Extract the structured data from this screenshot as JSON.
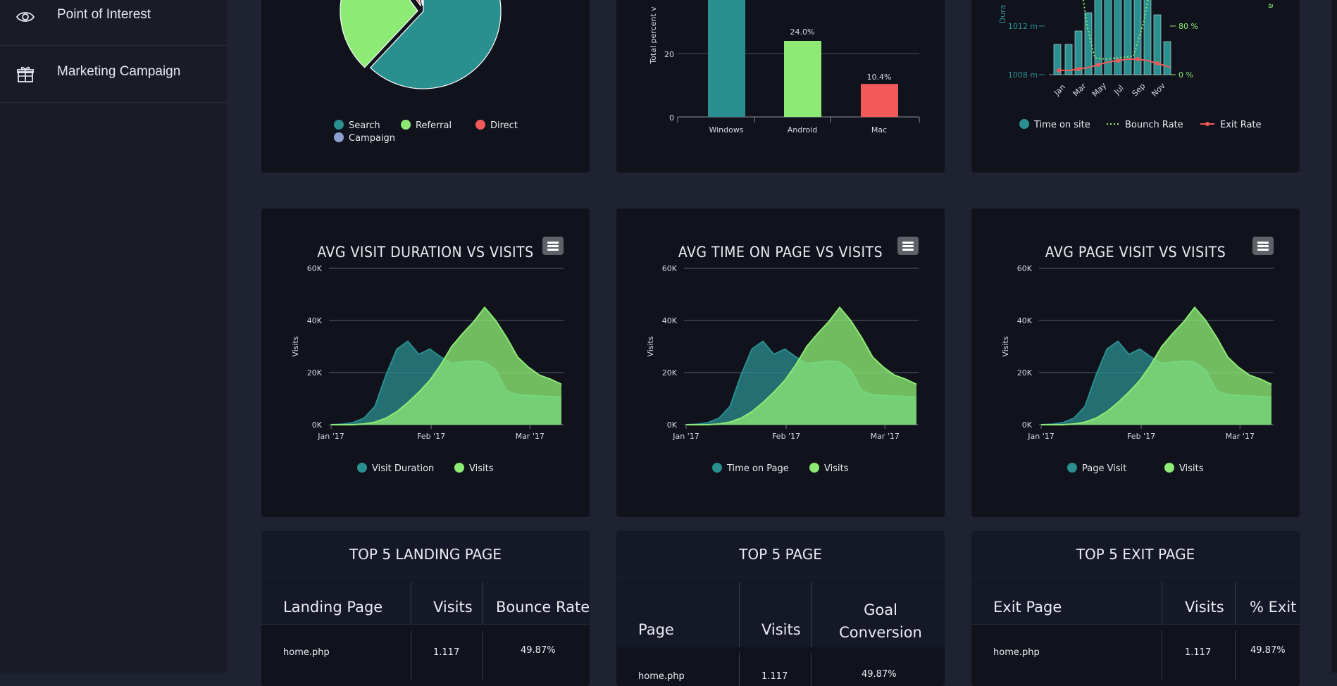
{
  "sidebar": {
    "items": [
      {
        "label": "Point of Interest",
        "icon": "eye-icon"
      },
      {
        "label": "Marketing Campaign",
        "icon": "gift-icon"
      }
    ]
  },
  "colors": {
    "teal": "#2a8f8f",
    "green": "#8deb75",
    "red": "#f25a5a",
    "blue": "#8b9fd1",
    "background": "#1f2231",
    "card": "#11131c"
  },
  "top_cards": {
    "pie": {
      "legend": [
        "Search",
        "Referral",
        "Direct",
        "Campaign"
      ]
    },
    "bar": {
      "ylabel": "Total percent v",
      "y_ticks": [
        "0",
        "20"
      ],
      "categories": [
        "Windows",
        "Android",
        "Mac"
      ],
      "labels": [
        "24.0%",
        "10.4%"
      ]
    },
    "combo": {
      "y_left_label": "Dura",
      "y_left_ticks": [
        "1012 m",
        "1008 m"
      ],
      "y_right_ticks": [
        "80 %",
        "0 %"
      ],
      "y_right_label": "a",
      "months": [
        "Jan",
        "Mar",
        "May",
        "Jul",
        "Sep",
        "Nov"
      ],
      "legend": [
        "Time on site",
        "Bounch Rate",
        "Exit Rate"
      ]
    }
  },
  "area_charts": [
    {
      "title": "AVG VISIT DURATION VS VISITS",
      "legend": [
        "Visit Duration",
        "Visits"
      ]
    },
    {
      "title": "AVG TIME ON PAGE VS VISITS",
      "legend": [
        "Time on Page",
        "Visits"
      ]
    },
    {
      "title": "AVG PAGE VISIT VS VISITS",
      "legend": [
        "Page Visit",
        "Visits"
      ]
    }
  ],
  "area_axes": {
    "ylabel": "Visits",
    "y_ticks": [
      "0K",
      "20K",
      "40K",
      "60K"
    ],
    "x_ticks": [
      "Jan '17",
      "Feb '17",
      "Mar '17"
    ]
  },
  "tables": [
    {
      "title": "TOP 5 LANDING PAGE",
      "headers": [
        "Landing Page",
        "Visits",
        "Bounce Rate"
      ],
      "row": [
        "home.php",
        "1.117",
        "49.87%"
      ]
    },
    {
      "title": "TOP 5 PAGE",
      "headers": [
        "Page",
        "Visits",
        "Goal Conversion Rate"
      ],
      "row": [
        "home.php",
        "1.117",
        "49.87%"
      ]
    },
    {
      "title": "TOP 5 EXIT PAGE",
      "headers": [
        "Exit Page",
        "Visits",
        "% Exit"
      ],
      "row": [
        "home.php",
        "1.117",
        "49.87%"
      ]
    }
  ],
  "chart_data": [
    {
      "type": "pie",
      "title": "",
      "categories": [
        "Search",
        "Referral",
        "Direct",
        "Campaign"
      ],
      "values": [
        62,
        28,
        6,
        4
      ]
    },
    {
      "type": "bar",
      "title": "",
      "ylabel": "Total percent v",
      "categories": [
        "Windows",
        "Android",
        "Mac"
      ],
      "values": [
        45,
        24.0,
        10.4
      ],
      "ylim": [
        0,
        40
      ]
    },
    {
      "type": "area",
      "title": "AVG VISIT DURATION VS VISITS",
      "ylabel": "Visits",
      "ylim": [
        0,
        60000
      ],
      "x": [
        0,
        4,
        8,
        12,
        16,
        20,
        24,
        28,
        32,
        36,
        40,
        44,
        48,
        52,
        56,
        60,
        64,
        68,
        72,
        76,
        80,
        84
      ],
      "x_labels": {
        "0": "Jan '17",
        "31": "Feb '17",
        "59": "Mar '17"
      },
      "series": [
        {
          "name": "Visit Duration",
          "values": [
            0,
            200,
            800,
            2500,
            7000,
            19000,
            29000,
            32000,
            27000,
            29000,
            26000,
            23500,
            24000,
            24500,
            24000,
            21000,
            13000,
            11500,
            11200,
            11000,
            10800,
            10500
          ]
        },
        {
          "name": "Visits",
          "values": [
            0,
            0,
            0,
            300,
            1000,
            2500,
            5000,
            8500,
            12500,
            17000,
            23000,
            30000,
            35000,
            39500,
            45000,
            40000,
            33500,
            26000,
            22000,
            19000,
            17500,
            15500
          ]
        }
      ]
    },
    {
      "type": "area",
      "title": "AVG TIME ON PAGE VS VISITS",
      "ylabel": "Visits",
      "ylim": [
        0,
        60000
      ],
      "x": [
        0,
        4,
        8,
        12,
        16,
        20,
        24,
        28,
        32,
        36,
        40,
        44,
        48,
        52,
        56,
        60,
        64,
        68,
        72,
        76,
        80,
        84
      ],
      "x_labels": {
        "0": "Jan '17",
        "31": "Feb '17",
        "59": "Mar '17"
      },
      "series": [
        {
          "name": "Time on Page",
          "values": [
            0,
            200,
            800,
            2500,
            7000,
            19000,
            29000,
            32000,
            27000,
            29000,
            26000,
            23500,
            24000,
            24500,
            24000,
            21000,
            13000,
            11500,
            11200,
            11000,
            10800,
            10500
          ]
        },
        {
          "name": "Visits",
          "values": [
            0,
            0,
            0,
            300,
            1000,
            2500,
            5000,
            8500,
            12500,
            17000,
            23000,
            30000,
            35000,
            39500,
            45000,
            40000,
            33500,
            26000,
            22000,
            19000,
            17500,
            15500
          ]
        }
      ]
    },
    {
      "type": "area",
      "title": "AVG PAGE VISIT VS VISITS",
      "ylabel": "Visits",
      "ylim": [
        0,
        60000
      ],
      "x": [
        0,
        4,
        8,
        12,
        16,
        20,
        24,
        28,
        32,
        36,
        40,
        44,
        48,
        52,
        56,
        60,
        64,
        68,
        72,
        76,
        80,
        84
      ],
      "x_labels": {
        "0": "Jan '17",
        "31": "Feb '17",
        "59": "Mar '17"
      },
      "series": [
        {
          "name": "Page Visit",
          "values": [
            0,
            200,
            800,
            2500,
            7000,
            19000,
            29000,
            32000,
            27000,
            29000,
            26000,
            23500,
            24000,
            24500,
            24000,
            21000,
            13000,
            11500,
            11200,
            11000,
            10800,
            10500
          ]
        },
        {
          "name": "Visits",
          "values": [
            0,
            0,
            0,
            300,
            1000,
            2500,
            5000,
            8500,
            12500,
            17000,
            23000,
            30000,
            35000,
            39500,
            45000,
            40000,
            33500,
            26000,
            22000,
            19000,
            17500,
            15500
          ]
        }
      ]
    }
  ]
}
